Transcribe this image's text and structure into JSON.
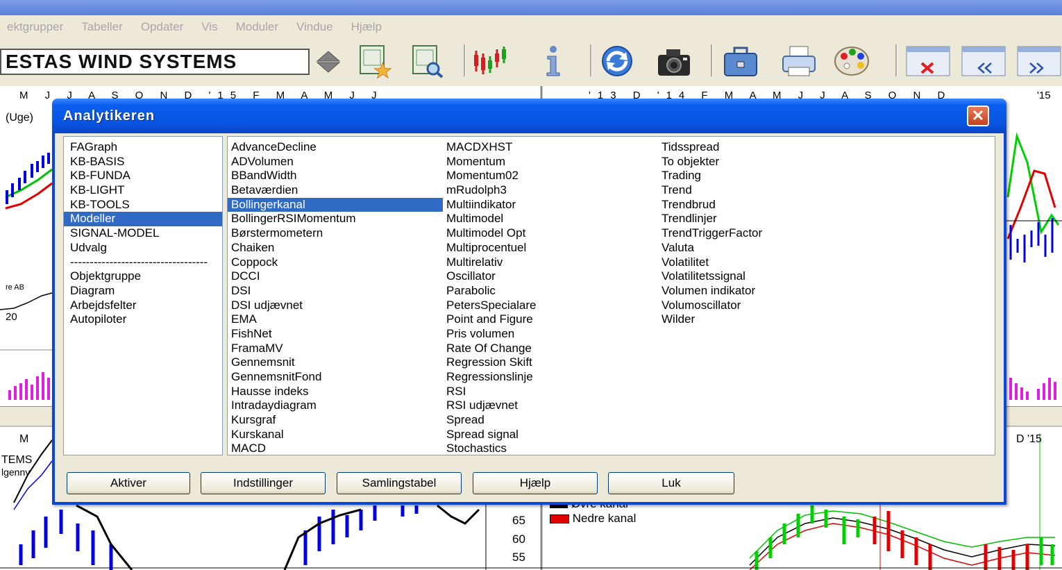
{
  "menu": [
    "ektgrupper",
    "Tabeller",
    "Opdater",
    "Vis",
    "Moduler",
    "Vindue",
    "Hjælp"
  ],
  "stock_selector": {
    "value": "ESTAS WIND SYSTEMS"
  },
  "toolbar_icons": [
    "certificate-star-icon",
    "certificate-search-icon",
    "candlestick-icon",
    "info-icon",
    "refresh-icon",
    "camera-icon",
    "briefcase-icon",
    "printer-icon",
    "palette-icon",
    "window-close-icon",
    "window-prev-icon",
    "window-next-icon"
  ],
  "background": {
    "left_month_axis": "M J J A S O N D '15 F M A M J J",
    "right_month_axis": "'13 D '14 F M A M J J A S O N D",
    "right_month_axis_end": "'15",
    "uge_label": "(Uge)",
    "label_ab": "re AB",
    "label_20": "20",
    "lower_left_axis": "M",
    "lower_stem": "TEMS",
    "lower_glim": "lgenny",
    "lower_right_axis": "D '15",
    "legend": [
      "Øvre kanal",
      "Nedre kanal"
    ],
    "legend_colors": [
      "#000000",
      "#e00000"
    ],
    "y_ticks": [
      "65",
      "60",
      "55"
    ]
  },
  "dialog": {
    "title": "Analytikeren",
    "close_label": "✕",
    "categories": [
      "FAGraph",
      "KB-BASIS",
      "KB-FUNDA",
      "KB-LIGHT",
      "KB-TOOLS",
      "Modeller",
      "SIGNAL-MODEL",
      "Udvalg"
    ],
    "selected_category": "Modeller",
    "separator": "-----------------------------------",
    "extra_categories": [
      "Objektgruppe",
      "Diagram",
      "Arbejdsfelter",
      "Autopiloter"
    ],
    "models_col1": [
      "AdvanceDecline",
      "ADVolumen",
      "BBandWidth",
      "Betaværdien",
      "Bollingerkanal",
      "BollingerRSIMomentum",
      "Børstermometern",
      "Chaiken",
      "Coppock",
      "DCCI",
      "DSI",
      "DSI udjævnet",
      "EMA",
      "FishNet",
      "FramaMV",
      "Gennemsnit",
      "GennemsnitFond",
      "Hausse indeks",
      "Intradaydiagram",
      "Kursgraf",
      "Kurskanal",
      "MACD"
    ],
    "models_col2": [
      "MACDXHST",
      "Momentum",
      "Momentum02",
      "mRudolph3",
      "Multiindikator",
      "Multimodel",
      "Multimodel Opt",
      "Multiprocentuel",
      "Multirelativ",
      "Oscillator",
      "Parabolic",
      "PetersSpecialare",
      "Point and Figure",
      "Pris volumen",
      "Rate Of Change",
      "Regression Skift",
      "Regressionslinje",
      "RSI",
      "RSI udjævnet",
      "Spread",
      "Spread signal",
      "Stochastics"
    ],
    "models_col3": [
      "Tidsspread",
      "To objekter",
      "Trading",
      "Trend",
      "Trendbrud",
      "Trendlinjer",
      "TrendTriggerFactor",
      "Valuta",
      "Volatilitet",
      "Volatilitetssignal",
      "Volumen indikator",
      "Volumoscillator",
      "Wilder"
    ],
    "selected_model": "Bollingerkanal",
    "buttons": {
      "activate": "Aktiver",
      "settings": "Indstillinger",
      "collection": "Samlingstabel",
      "help": "Hjælp",
      "close": "Luk"
    }
  }
}
